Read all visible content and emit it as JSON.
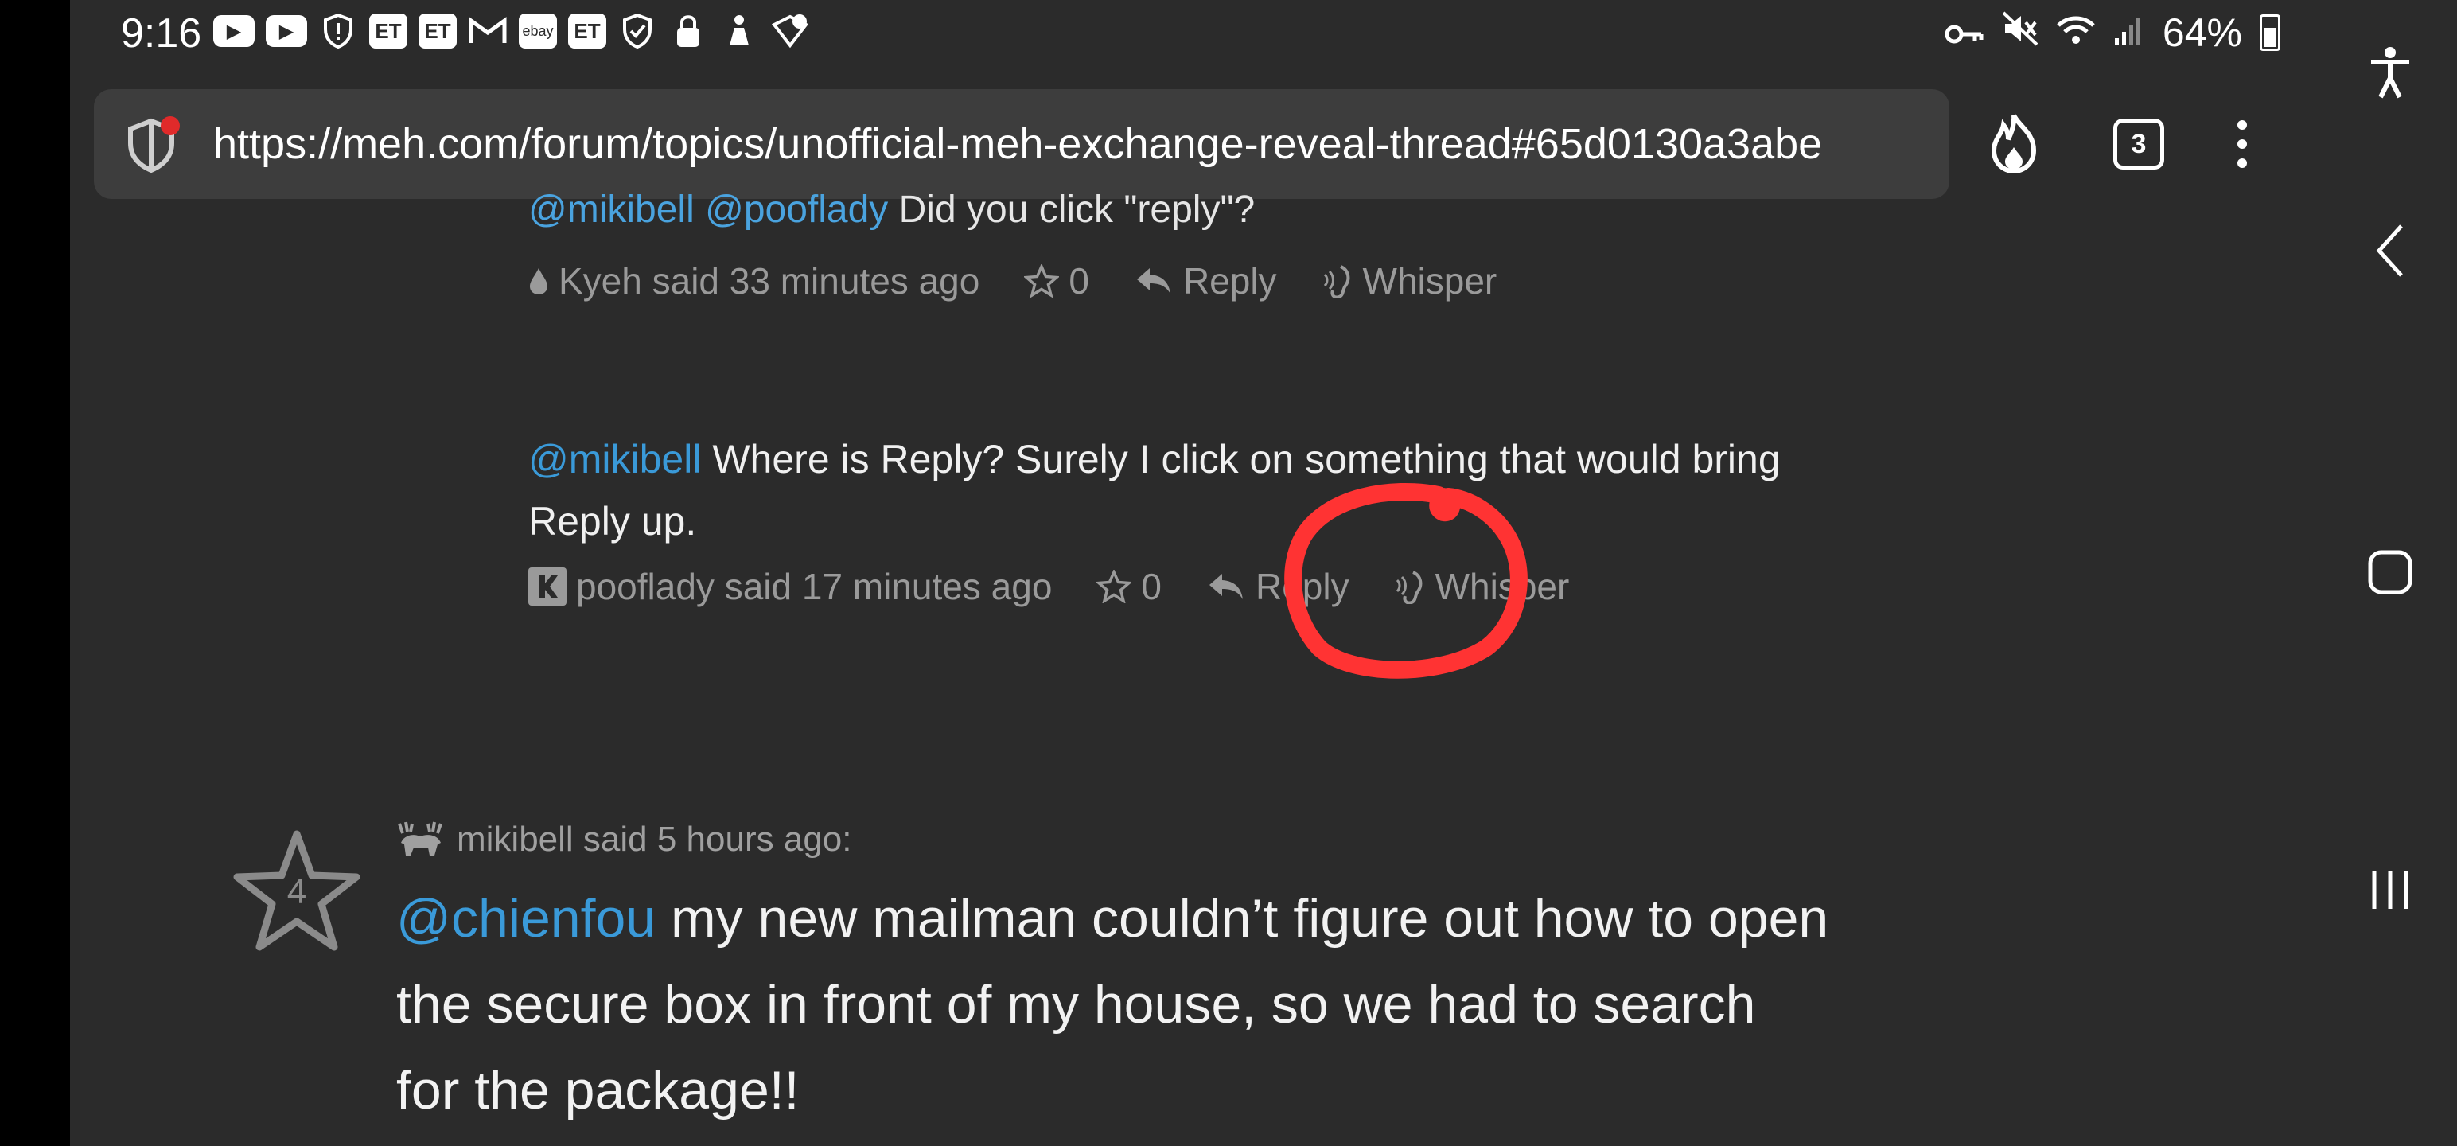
{
  "status_bar": {
    "time": "9:16",
    "battery": "64%",
    "notif_icons": [
      "youtube-icon",
      "youtube-icon",
      "shield-alert-icon",
      "et-icon",
      "et-icon",
      "gmail-icon",
      "ebay-icon",
      "et-icon",
      "shield-check-icon",
      "lock-icon",
      "person-icon",
      "map-check-icon"
    ],
    "et_label": "ET",
    "ebay_label": "ebay"
  },
  "browser": {
    "url": "https://meh.com/forum/topics/unofficial-meh-exchange-reveal-thread#65d0130a3abe",
    "tab_count": "3"
  },
  "comments": [
    {
      "partial_mentions": "@mikibell @pooflady",
      "partial_text": " Did you click \"reply\"?",
      "author_line": "Kyeh said 33 minutes ago",
      "stars": "0",
      "reply_label": "Reply",
      "whisper_label": "Whisper"
    },
    {
      "mention": "@mikibell",
      "text_line1": " Where is Reply? Surely I click on something that would bring",
      "text_line2": "Reply up.",
      "author_line": "pooflady said 17 minutes ago",
      "stars": "0",
      "reply_label": "Reply",
      "whisper_label": "Whisper"
    }
  ],
  "post": {
    "star_count": "4",
    "author_line": "mikibell said 5 hours ago:",
    "mention": "@chienfou",
    "text_line1": " my new mailman couldn’t figure out how to open",
    "text_line2": "the secure box in front of my house, so we had to search",
    "text_line3": "for the package!!"
  },
  "colors": {
    "background": "#2b2b2b",
    "mention": "#3a9ad9",
    "annotation": "#ff3030"
  }
}
